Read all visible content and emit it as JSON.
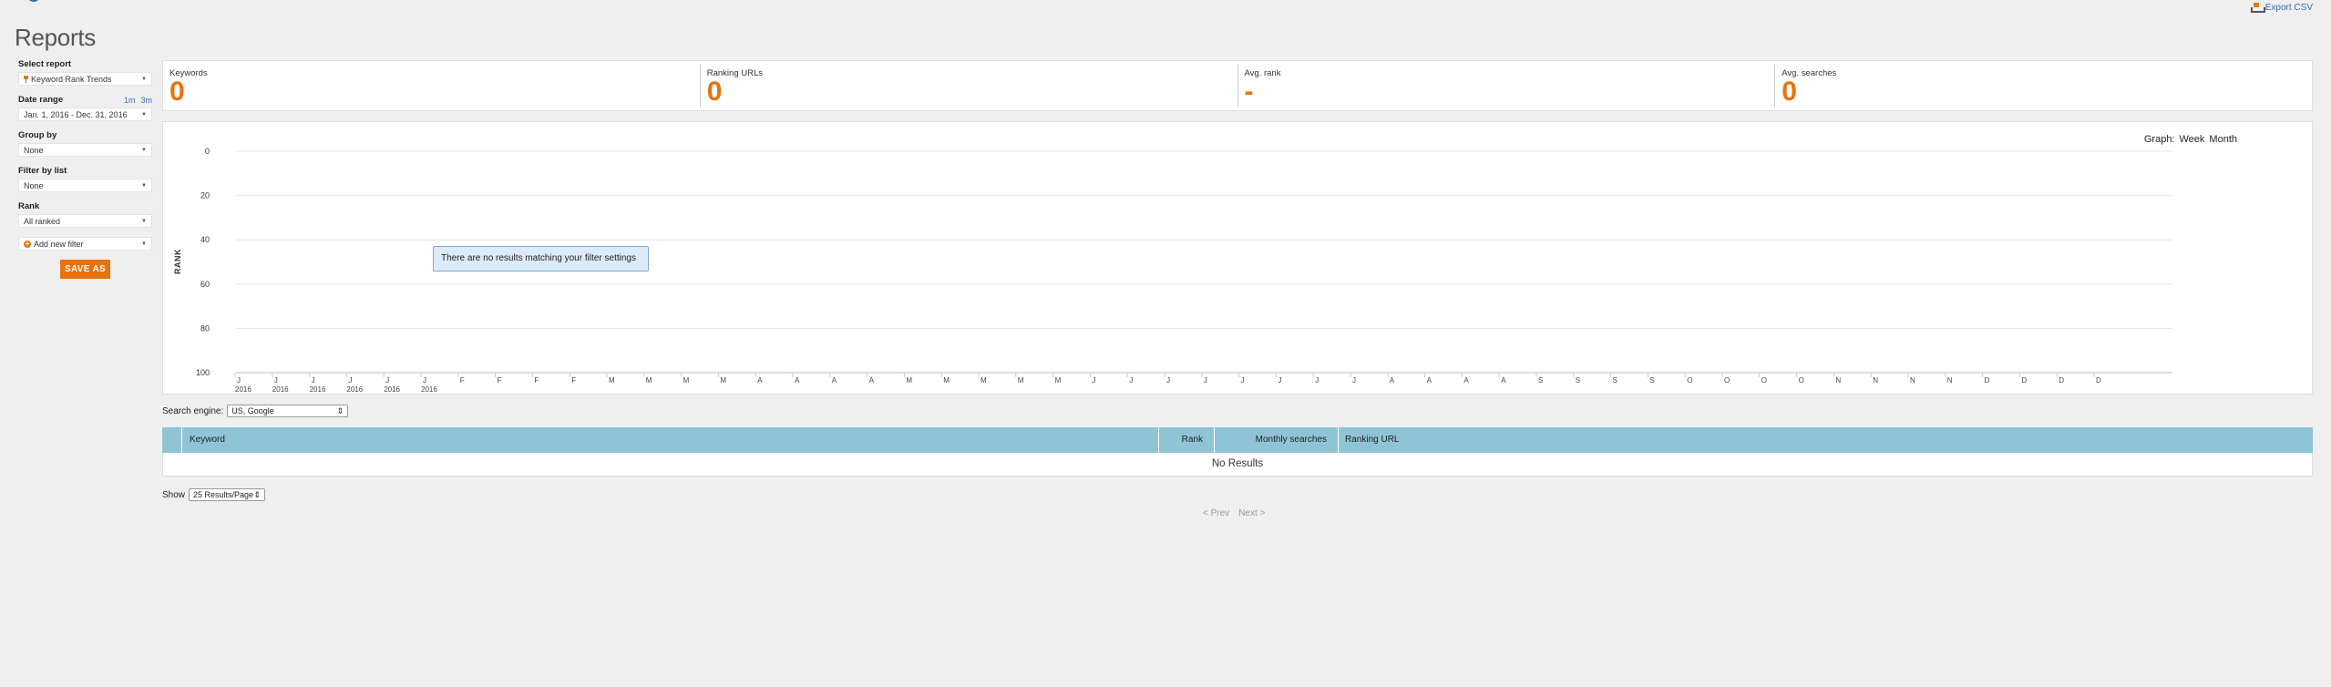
{
  "header": {
    "title": "Reports",
    "export_label": "Export CSV"
  },
  "sidebar": {
    "select_report_label": "Select report",
    "report_value": "Keyword Rank Trends",
    "date_range_label": "Date range",
    "quick_1m": "1m",
    "quick_3m": "3m",
    "date_range_value": "Jan. 1, 2016 - Dec. 31, 2016",
    "group_by_label": "Group by",
    "group_by_value": "None",
    "filter_list_label": "Filter by list",
    "filter_list_value": "None",
    "rank_label": "Rank",
    "rank_value": "All ranked",
    "add_filter_label": "Add new filter",
    "save_label": "SAVE AS"
  },
  "stats": [
    {
      "name": "Keywords",
      "value": "0"
    },
    {
      "name": "Ranking URLs",
      "value": "0"
    },
    {
      "name": "Avg. rank",
      "value": "-"
    },
    {
      "name": "Avg. searches",
      "value": "0"
    }
  ],
  "graph_toggle": {
    "label": "Graph:",
    "week": "Week",
    "month": "Month"
  },
  "chart_data": {
    "type": "line",
    "ylabel": "RANK",
    "y_ticks": [
      0,
      20,
      40,
      60,
      80,
      100
    ],
    "ylim": [
      0,
      100
    ],
    "y_reversed": true,
    "grid": true,
    "x_month_letters": [
      "J",
      "J",
      "J",
      "J",
      "J",
      "J",
      "F",
      "F",
      "F",
      "F",
      "M",
      "M",
      "M",
      "M",
      "A",
      "A",
      "A",
      "A",
      "M",
      "M",
      "M",
      "M",
      "M",
      "J",
      "J",
      "J",
      "J",
      "J",
      "J",
      "J",
      "J",
      "A",
      "A",
      "A",
      "A",
      "S",
      "S",
      "S",
      "S",
      "O",
      "O",
      "O",
      "O",
      "N",
      "N",
      "N",
      "N",
      "D",
      "D",
      "D",
      "D"
    ],
    "x_year_labels": [
      "2016",
      "2016",
      "2016",
      "2016",
      "2016",
      "2016"
    ],
    "series": [],
    "empty_message": "There are no results matching your filter settings"
  },
  "search_engine": {
    "label": "Search engine:",
    "value": "US, Google"
  },
  "table": {
    "columns": [
      "Keyword",
      "Rank",
      "Monthly searches",
      "Ranking URL"
    ],
    "empty_text": "No Results"
  },
  "pagination": {
    "show_label": "Show",
    "per_page": "25 Results/Page",
    "prev": "< Prev",
    "next": "Next >"
  }
}
